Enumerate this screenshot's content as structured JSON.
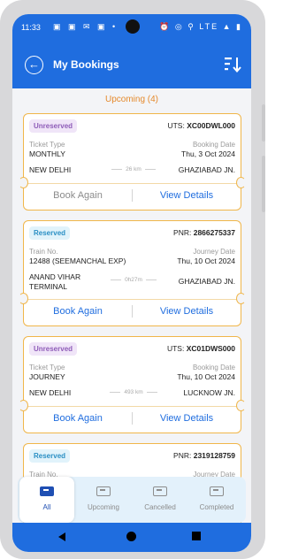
{
  "status_bar": {
    "time": "11:33",
    "left_icons": "▣ ▣ ✉ ▣ •",
    "right_icons": "⏰ ◎ ⚲ LTE ▲ ▮"
  },
  "header": {
    "title": "My Bookings"
  },
  "section": {
    "title": "Upcoming (4)"
  },
  "bookings": [
    {
      "badge": "Unreserved",
      "ref_label": "UTS:",
      "ref_value": "XC00DWL000",
      "left_label": "Ticket Type",
      "left_value": "MONTHLY",
      "right_label": "Booking Date",
      "right_value": "Thu, 3 Oct 2024",
      "from": "NEW DELHI",
      "distance": "26 km",
      "to": "GHAZIABAD JN.",
      "action_left": "Book Again",
      "action_right": "View Details"
    },
    {
      "badge": "Reserved",
      "ref_label": "PNR:",
      "ref_value": "2866275337",
      "left_label": "Train No.",
      "left_value": "12488 (SEEMANCHAL EXP)",
      "right_label": "Journey Date",
      "right_value": "Thu, 10 Oct 2024",
      "from": "ANAND VIHAR TERMINAL",
      "distance": "0h27m",
      "to": "GHAZIABAD JN.",
      "action_left": "Book Again",
      "action_right": "View Details"
    },
    {
      "badge": "Unreserved",
      "ref_label": "UTS:",
      "ref_value": "XC01DWS000",
      "left_label": "Ticket Type",
      "left_value": "JOURNEY",
      "right_label": "Booking Date",
      "right_value": "Thu, 10 Oct 2024",
      "from": "NEW DELHI",
      "distance": "493 km",
      "to": "LUCKNOW JN.",
      "action_left": "Book Again",
      "action_right": "View Details"
    },
    {
      "badge": "Reserved",
      "ref_label": "PNR:",
      "ref_value": "2319128759",
      "left_label": "Train No.",
      "right_label": "Journey Date"
    }
  ],
  "tabs": [
    {
      "label": "All",
      "active": true
    },
    {
      "label": "Upcoming"
    },
    {
      "label": "Cancelled"
    },
    {
      "label": "Completed"
    }
  ],
  "colors": {
    "primary": "#1f6ddf",
    "accent_orange": "#e58a2d",
    "card_border": "#f0b64a",
    "unreserved_badge": "#8e5cb8",
    "reserved_badge": "#2a8fc4"
  },
  "icons": {
    "back": "arrow-left-circle-icon",
    "sort": "sort-descending-icon",
    "tab": "ticket-icon"
  }
}
